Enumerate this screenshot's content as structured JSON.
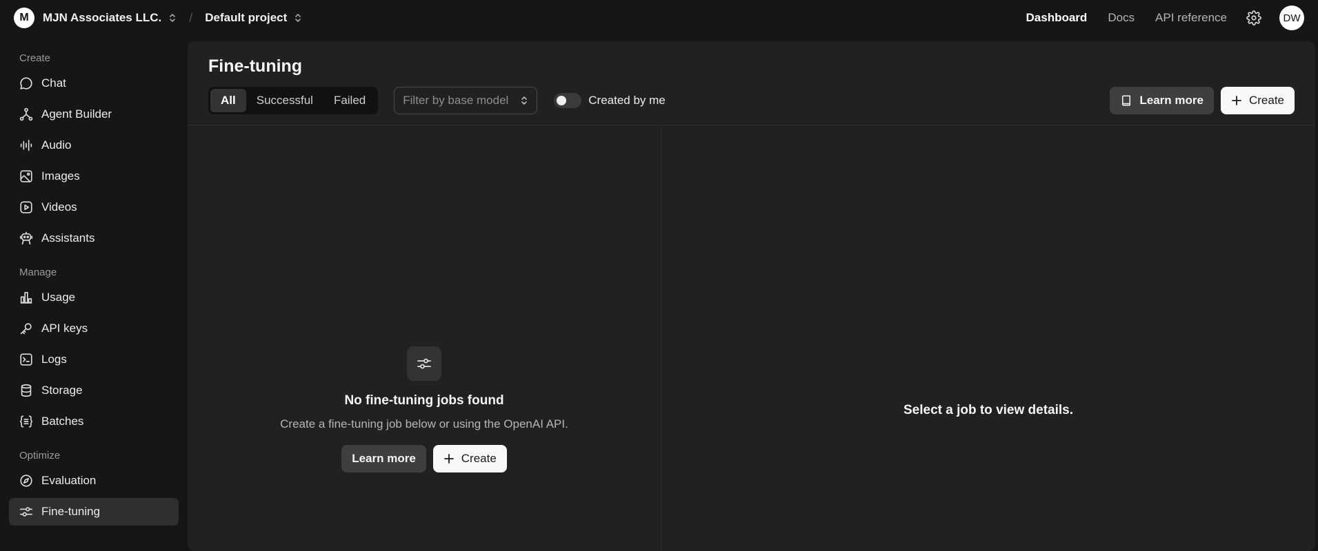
{
  "header": {
    "org_initial": "M",
    "org_name": "MJN Associates LLC.",
    "separator": "/",
    "project_name": "Default project",
    "links": {
      "dashboard": "Dashboard",
      "docs": "Docs",
      "api_reference": "API reference"
    },
    "user_initials": "DW"
  },
  "sidebar": {
    "sections": [
      {
        "title": "Create",
        "items": [
          {
            "label": "Chat",
            "icon": "chat-icon"
          },
          {
            "label": "Agent Builder",
            "icon": "agent-builder-icon"
          },
          {
            "label": "Audio",
            "icon": "audio-icon"
          },
          {
            "label": "Images",
            "icon": "image-icon"
          },
          {
            "label": "Videos",
            "icon": "video-icon"
          },
          {
            "label": "Assistants",
            "icon": "robot-icon"
          }
        ]
      },
      {
        "title": "Manage",
        "items": [
          {
            "label": "Usage",
            "icon": "bar-chart-icon"
          },
          {
            "label": "API keys",
            "icon": "key-icon"
          },
          {
            "label": "Logs",
            "icon": "terminal-icon"
          },
          {
            "label": "Storage",
            "icon": "database-icon"
          },
          {
            "label": "Batches",
            "icon": "batches-icon"
          }
        ]
      },
      {
        "title": "Optimize",
        "items": [
          {
            "label": "Evaluation",
            "icon": "compass-icon"
          },
          {
            "label": "Fine-tuning",
            "icon": "sliders-icon",
            "selected": true
          }
        ]
      }
    ]
  },
  "main": {
    "title": "Fine-tuning",
    "tabs": [
      "All",
      "Successful",
      "Failed"
    ],
    "active_tab": "All",
    "filter_placeholder": "Filter by base model",
    "toggle_label": "Created by me",
    "toggle_on": false,
    "learn_more_label": "Learn more",
    "create_label": "Create",
    "empty_title": "No fine-tuning jobs found",
    "empty_desc": "Create a fine-tuning job below or using the OpenAI API.",
    "empty_learn_more": "Learn more",
    "empty_create": "Create",
    "details_placeholder": "Select a job to view details."
  }
}
